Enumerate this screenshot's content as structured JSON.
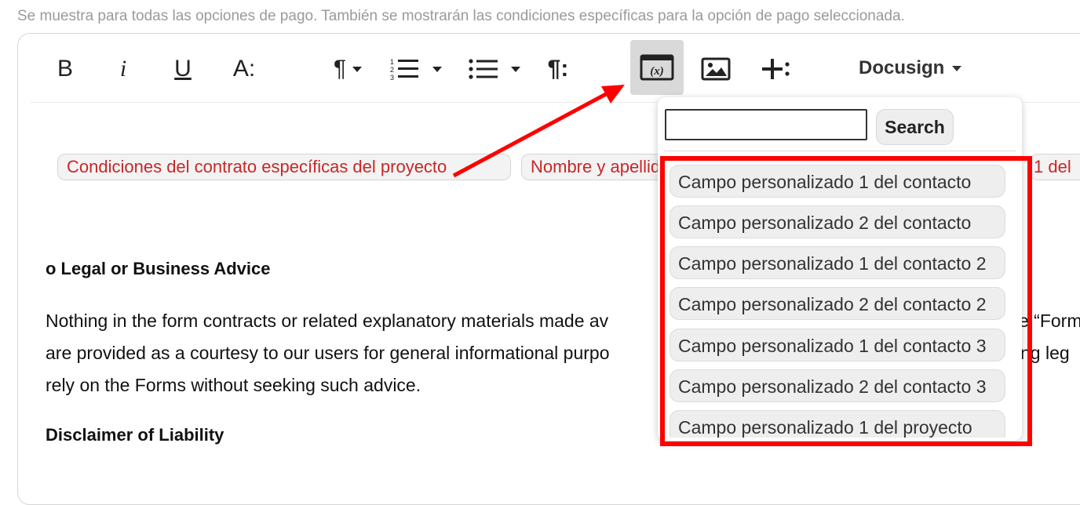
{
  "hint": "Se muestra para todas las opciones de pago. También se mostrarán las condiciones específicas para la opción de pago seleccionada.",
  "toolbar": {
    "bold": "B",
    "italic": "i",
    "underline": "U",
    "font_size": "A:",
    "docusign_label": "Docusign"
  },
  "chips": [
    "Condiciones del contrato específicas del proyecto",
    "Nombre y apellido",
    "1 del"
  ],
  "document": {
    "heading1": "o Legal or Business Advice",
    "para_line1": "Nothing in the form contracts or related explanatory materials made av",
    "para_line1_end": "e “Form",
    "para_line2": "are provided as a courtesy to our users for general informational purpo",
    "para_line2_end": "ng leg",
    "para_line3": "rely on the Forms without seeking such advice.",
    "heading2": "Disclaimer of Liability"
  },
  "dropdown": {
    "search_value": "",
    "search_button": "Search",
    "items": [
      "Campo personalizado 1 del contacto",
      "Campo personalizado 2 del contacto",
      "Campo personalizado 1 del contacto 2",
      "Campo personalizado 2 del contacto 2",
      "Campo personalizado 1 del contacto 3",
      "Campo personalizado 2 del contacto 3",
      "Campo personalizado 1 del proyecto"
    ]
  },
  "colors": {
    "annotation_red": "#ff0000",
    "chip_text": "#c62828",
    "active_button_bg": "#d9d9d9"
  }
}
